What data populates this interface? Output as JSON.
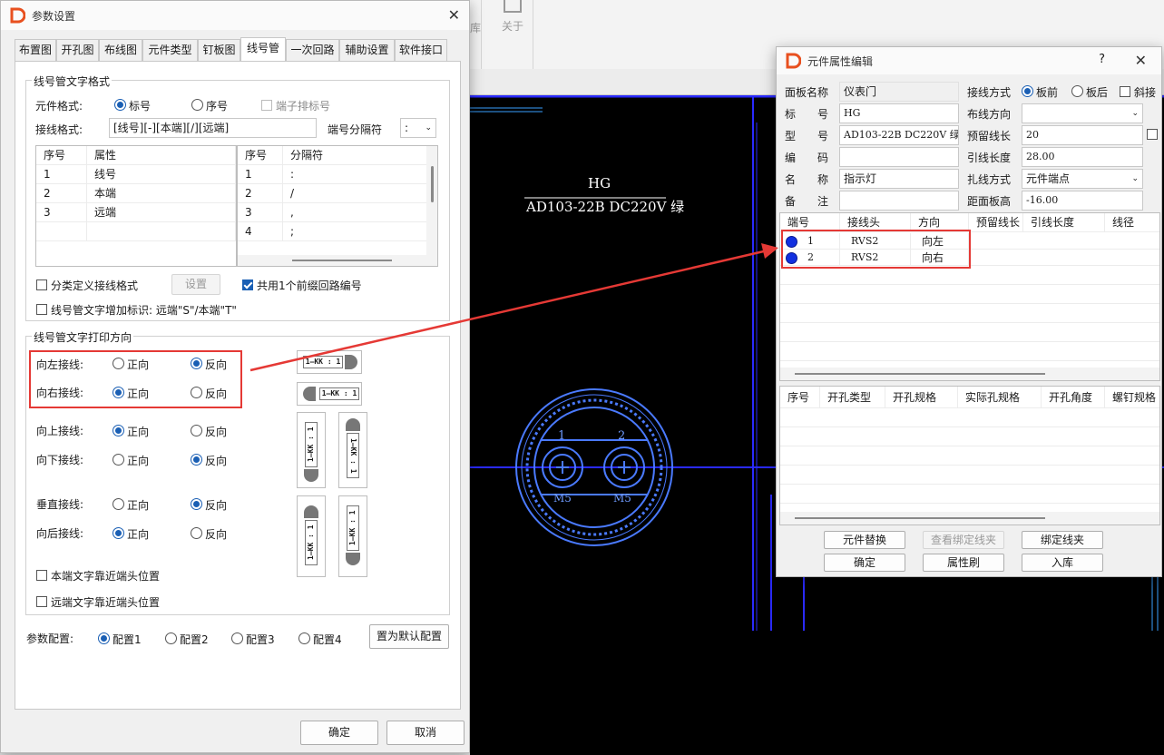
{
  "background": {
    "ribbon_button": "关于",
    "ribbon_partial": "库",
    "drawing_text_1": "HG",
    "drawing_text_2": "AD103-22B DC220V 绿",
    "pin_1": "1",
    "pin_2": "2",
    "screw_1": "M5",
    "screw_2": "M5"
  },
  "param_dialog": {
    "title": "参数设置",
    "tabs": [
      "布置图",
      "开孔图",
      "布线图",
      "元件类型",
      "钉板图",
      "线号管",
      "一次回路",
      "辅助设置",
      "软件接口"
    ],
    "format_group": "线号管文字格式",
    "component_format_label": "元件格式:",
    "opt_label": "标号",
    "opt_seq": "序号",
    "opt_terminal": "端子排标号",
    "wiring_format_label": "接线格式:",
    "wiring_format_value": "[线号][-][本端][/][远端]",
    "separator_label": "端号分隔符",
    "separator_value": ":",
    "left_table": {
      "headers": [
        "序号",
        "属性"
      ],
      "rows": [
        [
          "1",
          "线号"
        ],
        [
          "2",
          "本端"
        ],
        [
          "3",
          "远端"
        ]
      ]
    },
    "right_table": {
      "headers": [
        "序号",
        "分隔符"
      ],
      "rows": [
        [
          "1",
          ":"
        ],
        [
          "2",
          "/"
        ],
        [
          "3",
          ","
        ],
        [
          "4",
          ";"
        ]
      ]
    },
    "classify_label": "分类定义接线格式",
    "settings_btn": "设置",
    "share_prefix_label": "共用1个前缀回路编号",
    "add_mark_label": "线号管文字增加标识: 远端\"S\"/本端\"T\"",
    "direction_group": "线号管文字打印方向",
    "forward": "正向",
    "reverse": "反向",
    "dir_left": "向左接线:",
    "dir_right": "向右接线:",
    "dir_up": "向上接线:",
    "dir_down": "向下接线:",
    "dir_vertical": "垂直接线:",
    "dir_back": "向后接线:",
    "near_local": "本端文字靠近端头位置",
    "near_remote": "远端文字靠近端头位置",
    "sleeve_text": "1—KK : 1",
    "config_label": "参数配置:",
    "configs": [
      "配置1",
      "配置2",
      "配置3",
      "配置4"
    ],
    "default_btn": "置为默认配置",
    "ok": "确定",
    "cancel": "取消"
  },
  "prop_dialog": {
    "title": "元件属性编辑",
    "help": "?",
    "fields": {
      "panel_name_label": "面板名称",
      "panel_name": "仪表门",
      "label_label": "标　　号",
      "label": "HG",
      "model_label": "型　　号",
      "model": "AD103-22B DC220V 绿",
      "code_label": "编　　码",
      "code": "",
      "name_label": "名　　称",
      "name": "指示灯",
      "note_label": "备　　注",
      "note": "",
      "wiring_mode_label": "接线方式",
      "wiring_front": "板前",
      "wiring_back": "板后",
      "slant": "斜接",
      "route_dir_label": "布线方向",
      "route_dir": "",
      "reserve_len_label": "预留线长",
      "reserve_len": "20",
      "lead_len_label": "引线长度",
      "lead_len": "28.00",
      "bind_mode_label": "扎线方式",
      "bind_mode": "元件端点",
      "board_height_label": "距面板高",
      "board_height": "-16.00"
    },
    "terminal_table": {
      "headers": [
        "端号",
        "接线头",
        "方向",
        "预留线长",
        "引线长度",
        "线径"
      ],
      "rows": [
        [
          "1",
          "RVS2",
          "向左"
        ],
        [
          "2",
          "RVS2",
          "向右"
        ]
      ]
    },
    "hole_table": {
      "headers": [
        "序号",
        "开孔类型",
        "开孔规格",
        "实际孔规格",
        "开孔角度",
        "螺钉规格"
      ]
    },
    "buttons": {
      "replace": "元件替换",
      "view_bind": "查看绑定线夹",
      "bind": "绑定线夹",
      "ok": "确定",
      "brush": "属性刷",
      "store": "入库"
    }
  },
  "colors": {
    "accent": "#1a5fb4",
    "annot": "#e53935",
    "cad_blue": "#2020ff"
  }
}
